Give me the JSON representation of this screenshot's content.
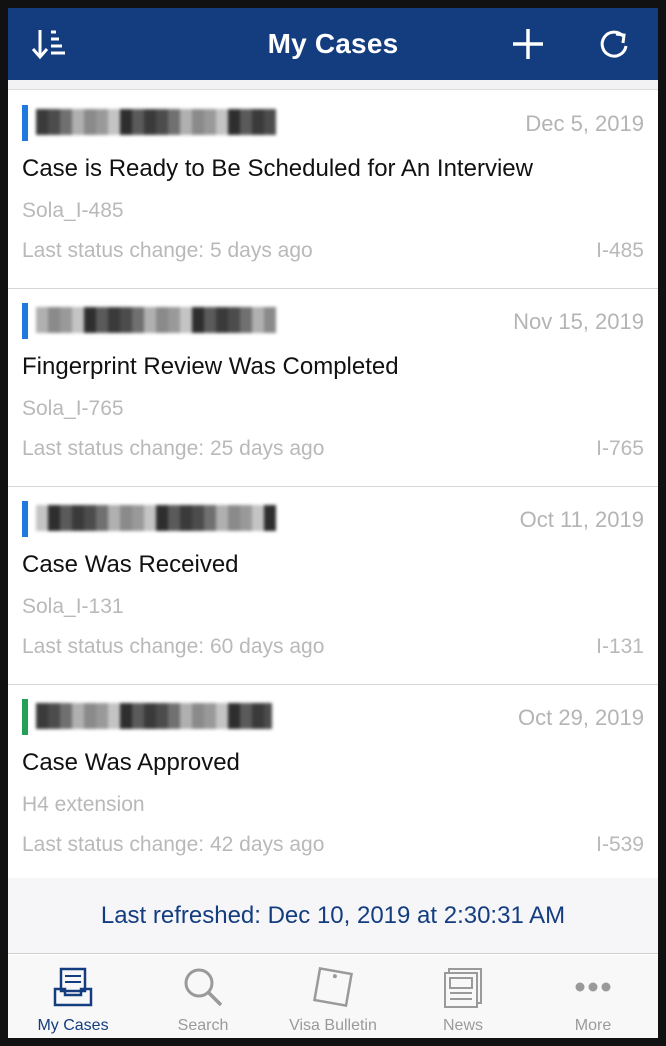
{
  "header": {
    "title": "My Cases",
    "sort_icon": "sort-icon",
    "add_icon": "plus-icon",
    "refresh_icon": "refresh-icon",
    "color": "#143d80"
  },
  "cases": [
    {
      "status_color": "#1f7ae0",
      "date": "Dec 5, 2019",
      "status": "Case is Ready to Be Scheduled for An Interview",
      "label": "Sola_I-485",
      "last_change": "Last status change: 5 days ago",
      "form": "I-485"
    },
    {
      "status_color": "#1f7ae0",
      "date": "Nov 15, 2019",
      "status": "Fingerprint Review Was Completed",
      "label": "Sola_I-765",
      "last_change": "Last status change: 25 days ago",
      "form": "I-765"
    },
    {
      "status_color": "#1f7ae0",
      "date": "Oct 11, 2019",
      "status": "Case Was Received",
      "label": "Sola_I-131",
      "last_change": "Last status change: 60 days ago",
      "form": "I-131"
    },
    {
      "status_color": "#22a055",
      "date": "Oct 29, 2019",
      "status": "Case Was Approved",
      "label": "H4 extension",
      "last_change": "Last status change: 42 days ago",
      "form": "I-539"
    }
  ],
  "footer": {
    "last_refreshed": "Last refreshed: Dec 10, 2019 at 2:30:31 AM"
  },
  "tabs": [
    {
      "label": "My Cases",
      "icon": "inbox-tray-icon",
      "active": true
    },
    {
      "label": "Search",
      "icon": "search-icon",
      "active": false
    },
    {
      "label": "Visa Bulletin",
      "icon": "bulletin-icon",
      "active": false
    },
    {
      "label": "News",
      "icon": "news-icon",
      "active": false
    },
    {
      "label": "More",
      "icon": "more-dots-icon",
      "active": false
    }
  ]
}
